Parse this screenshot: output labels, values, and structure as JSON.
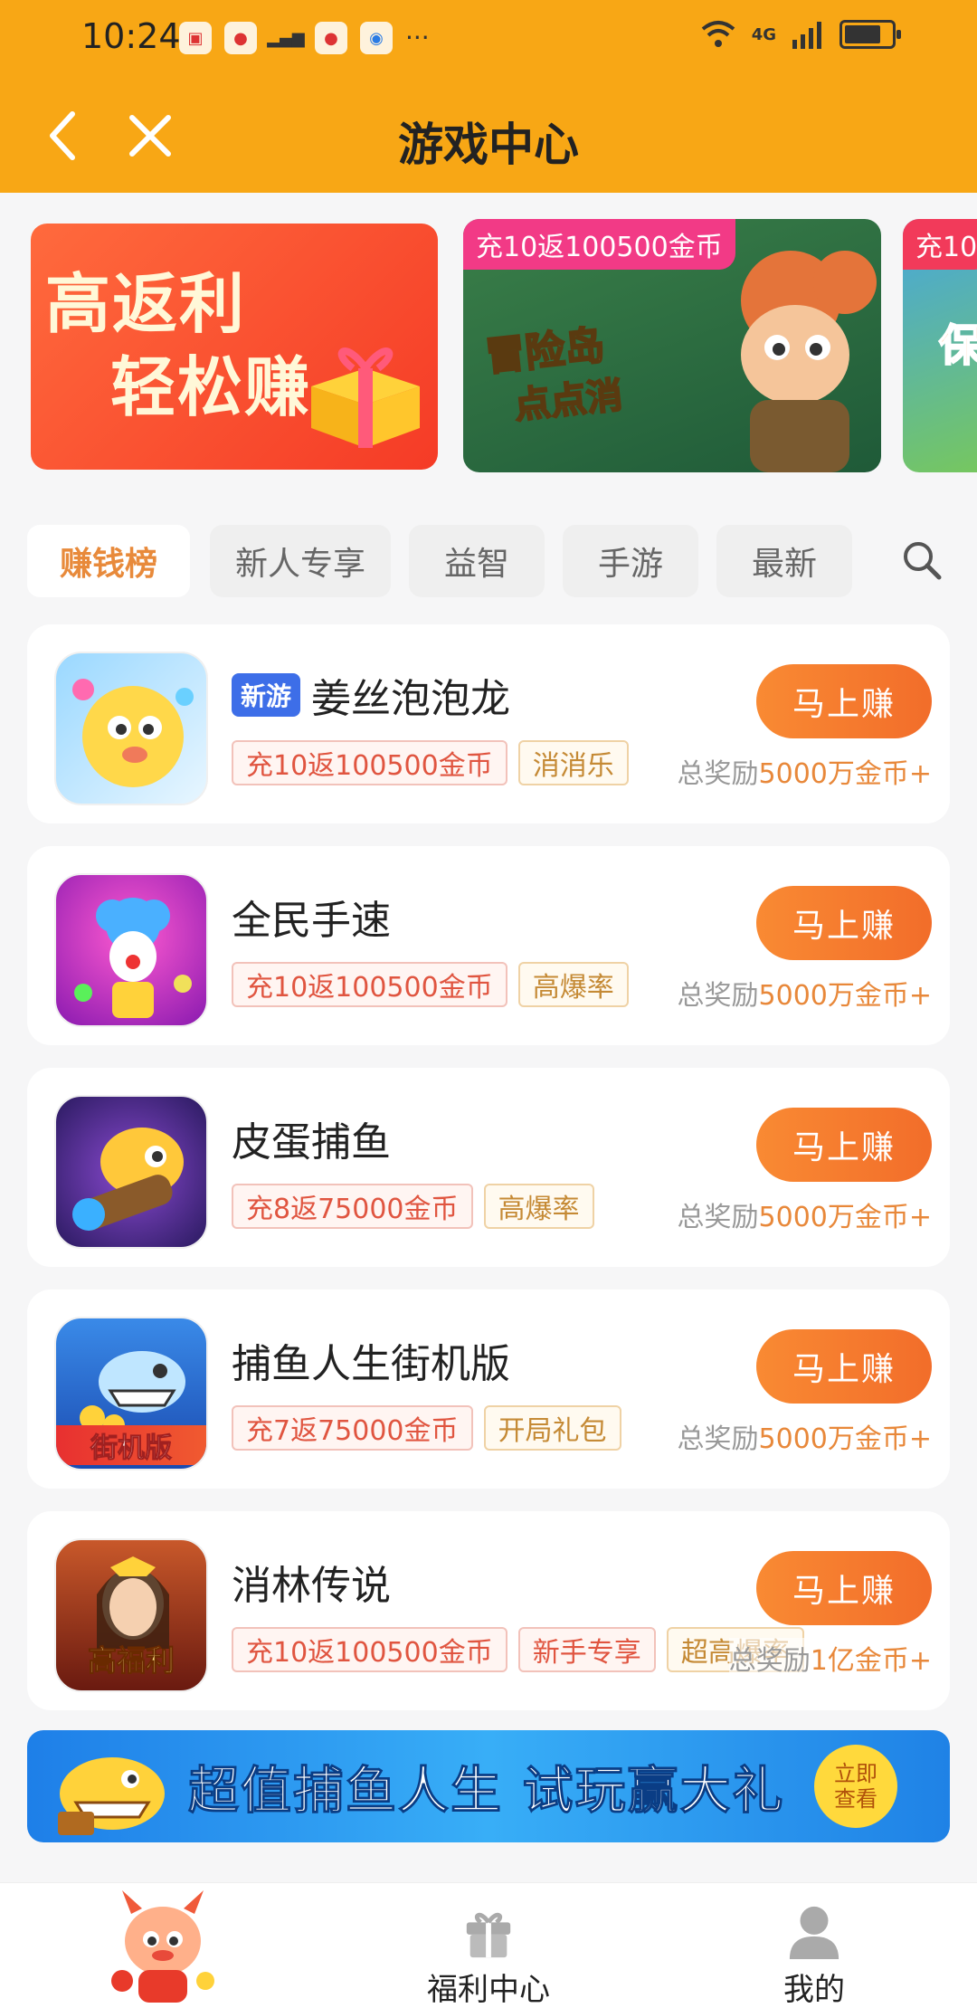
{
  "status_bar": {
    "time": "10:24",
    "signal": "4G"
  },
  "header": {
    "title": "游戏中心"
  },
  "banners": [
    {
      "line1": "高返利",
      "line2": "轻松赚"
    },
    {
      "tag": "充10返100500金币",
      "title": "冒险岛",
      "subtitle": "点点消"
    },
    {
      "tag": "充10",
      "title": "保"
    }
  ],
  "tabs": [
    "赚钱榜",
    "新人专享",
    "益智",
    "手游",
    "最新"
  ],
  "games": [
    {
      "name": "姜丝泡泡龙",
      "badge": "新游",
      "tags": [
        {
          "text": "充10返100500金币",
          "style": "red"
        },
        {
          "text": "消消乐",
          "style": "gold"
        }
      ],
      "button": "马上赚",
      "reward_label": "总奖励",
      "reward_amount": "5000万金币+"
    },
    {
      "name": "全民手速",
      "tags": [
        {
          "text": "充10返100500金币",
          "style": "red"
        },
        {
          "text": "高爆率",
          "style": "gold"
        }
      ],
      "button": "马上赚",
      "reward_label": "总奖励",
      "reward_amount": "5000万金币+"
    },
    {
      "name": "皮蛋捕鱼",
      "tags": [
        {
          "text": "充8返75000金币",
          "style": "red"
        },
        {
          "text": "高爆率",
          "style": "gold"
        }
      ],
      "button": "马上赚",
      "reward_label": "总奖励",
      "reward_amount": "5000万金币+"
    },
    {
      "name": "捕鱼人生街机版",
      "icon_text": "街机版",
      "tags": [
        {
          "text": "充7返75000金币",
          "style": "red"
        },
        {
          "text": "开局礼包",
          "style": "gold"
        }
      ],
      "button": "马上赚",
      "reward_label": "总奖励",
      "reward_amount": "5000万金币+"
    },
    {
      "name": "消林传说",
      "icon_text": "高福利",
      "tags": [
        {
          "text": "充10返100500金币",
          "style": "red"
        },
        {
          "text": "新手专享",
          "style": "red"
        },
        {
          "text": "超高爆率",
          "style": "gold"
        }
      ],
      "button": "马上赚",
      "reward_label": "总奖励",
      "reward_amount": "1亿金币+"
    }
  ],
  "ad_banner": {
    "text": "超值捕鱼人生 试玩赢大礼",
    "cta_line1": "立即",
    "cta_line2": "查看"
  },
  "bottom_nav": [
    {
      "label": ""
    },
    {
      "label": "福利中心"
    },
    {
      "label": "我的"
    }
  ]
}
